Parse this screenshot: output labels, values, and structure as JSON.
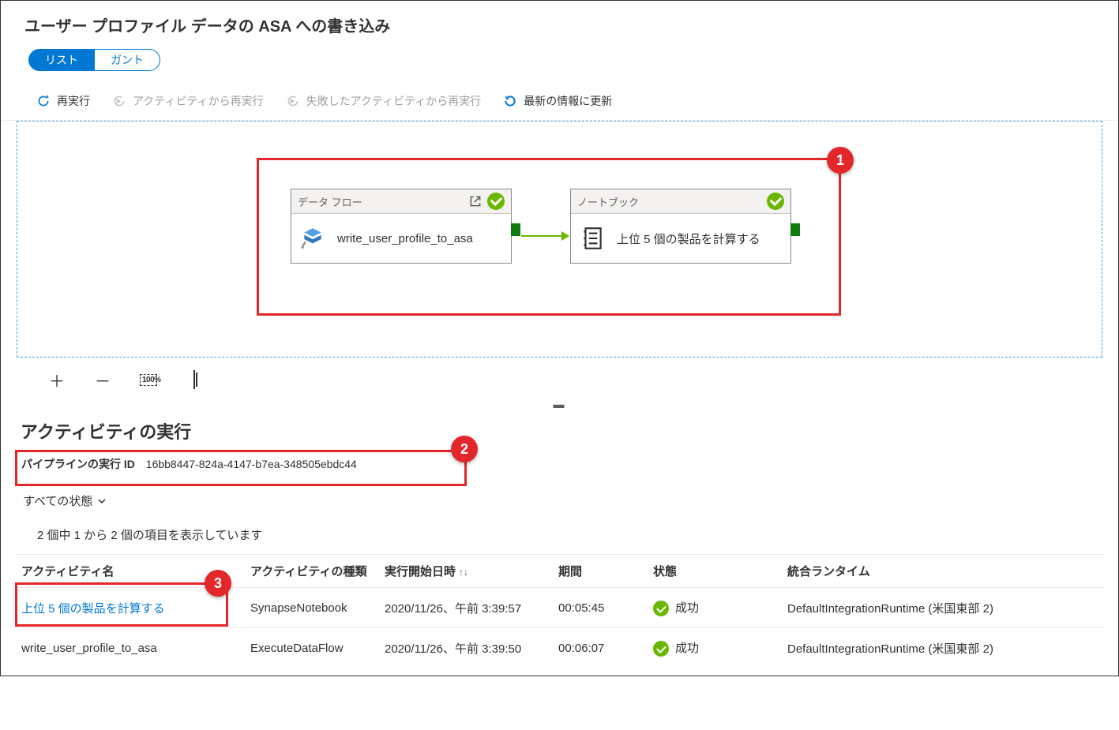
{
  "header": {
    "title": "ユーザー プロファイル データの ASA への書き込み"
  },
  "view_toggle": {
    "list": "リスト",
    "gantt": "ガント"
  },
  "toolbar": {
    "rerun": "再実行",
    "rerun_from_activity": "アクティビティから再実行",
    "rerun_from_failed": "失敗したアクティビティから再実行",
    "refresh": "最新の情報に更新"
  },
  "canvas": {
    "activities": [
      {
        "type_label": "データ フロー",
        "name": "write_user_profile_to_asa"
      },
      {
        "type_label": "ノートブック",
        "name": "上位 5 個の製品を計算する"
      }
    ],
    "zoom100": "100%"
  },
  "callouts": {
    "c1": "1",
    "c2": "2",
    "c3": "3"
  },
  "activity_runs": {
    "section_title": "アクティビティの実行",
    "run_id_label": "パイプラインの実行 ID",
    "run_id_value": "16bb8447-824a-4147-b7ea-348505ebdc44",
    "filter_label": "すべての状態",
    "count_text": "2 個中 1 から 2 個の項目を表示しています",
    "columns": {
      "name": "アクティビティ名",
      "type": "アクティビティの種類",
      "start": "実行開始日時",
      "duration": "期間",
      "status": "状態",
      "ir": "統合ランタイム"
    },
    "status_success": "成功",
    "rows": [
      {
        "name": "上位 5 個の製品を計算する",
        "type": "SynapseNotebook",
        "start": "2020/11/26、午前 3:39:57",
        "duration": "00:05:45",
        "ir": "DefaultIntegrationRuntime (米国東部 2)"
      },
      {
        "name": "write_user_profile_to_asa",
        "type": "ExecuteDataFlow",
        "start": "2020/11/26、午前 3:39:50",
        "duration": "00:06:07",
        "ir": "DefaultIntegrationRuntime (米国東部 2)"
      }
    ]
  }
}
